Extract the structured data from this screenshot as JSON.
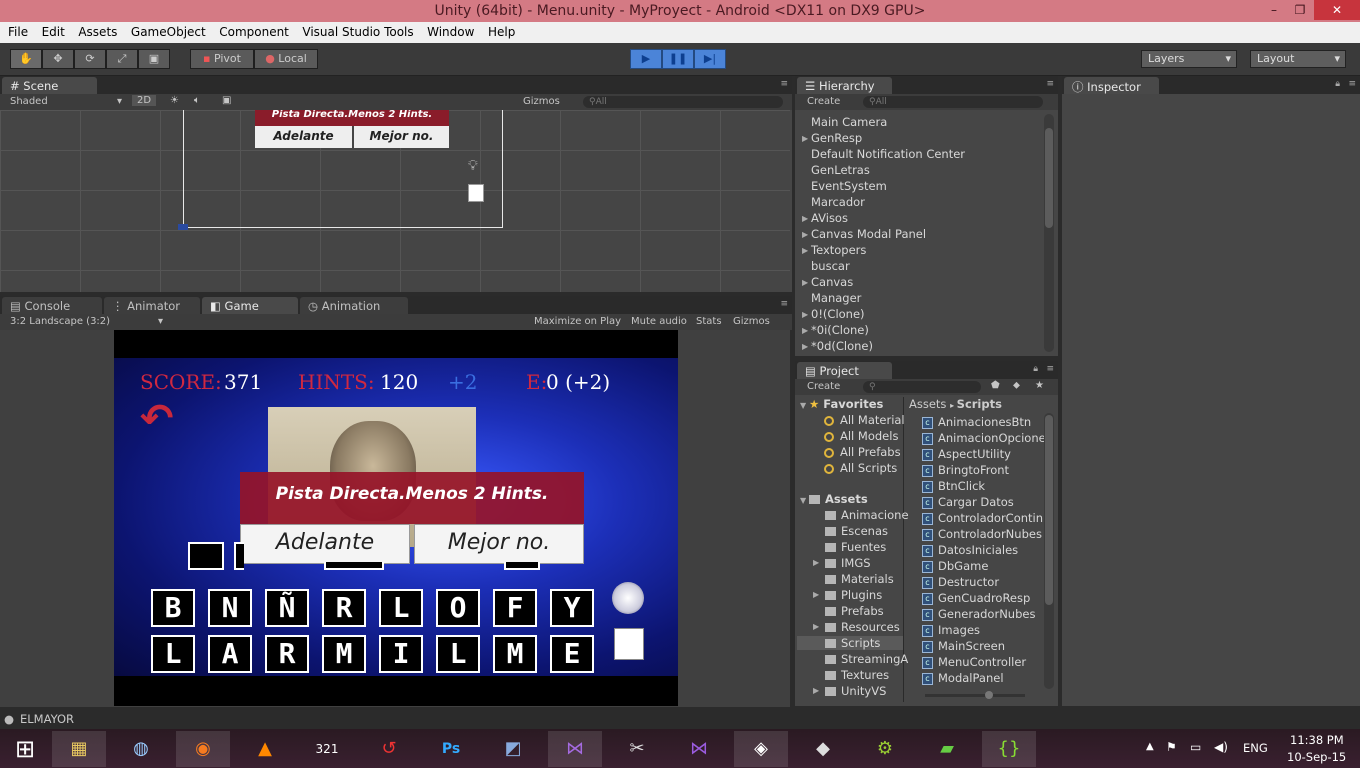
{
  "window": {
    "title": "Unity (64bit) - Menu.unity - MyProyect - Android <DX11 on DX9 GPU>"
  },
  "menu": [
    "File",
    "Edit",
    "Assets",
    "GameObject",
    "Component",
    "Visual Studio Tools",
    "Window",
    "Help"
  ],
  "toolbar": {
    "pivot": "Pivot",
    "local": "Local",
    "layers": "Layers",
    "layout": "Layout"
  },
  "scene": {
    "tab": "Scene",
    "shading": "Shaded",
    "mode2d": "2D",
    "gizmos": "Gizmos",
    "search": "All",
    "popup_text": "Pista Directa.Menos 2 Hints.",
    "btn1": "Adelante",
    "btn2": "Mejor no."
  },
  "bottom_tabs": {
    "console": "Console",
    "animator": "Animator",
    "game": "Game",
    "animation": "Animation"
  },
  "game": {
    "aspect": "3:2 Landscape (3:2)",
    "toolbar": [
      "Maximize on Play",
      "Mute audio",
      "Stats",
      "Gizmos"
    ],
    "score_label": "SCORE:",
    "score_value": "371",
    "hints_label": "HINTS:",
    "hints_value": "120",
    "hints_bonus": "+2",
    "e_label": "E:",
    "e_value": "0 (+2)",
    "popup_text": "Pista Directa.Menos 2 Hints.",
    "btn_continue": "Adelante",
    "btn_cancel": "Mejor no.",
    "letters_row1": [
      "B",
      "N",
      "Ñ",
      "R",
      "L",
      "O",
      "F",
      "Y"
    ],
    "letters_row2": [
      "L",
      "A",
      "R",
      "M",
      "I",
      "L",
      "M",
      "E"
    ]
  },
  "hierarchy": {
    "tab": "Hierarchy",
    "create": "Create",
    "search": "All",
    "items": [
      {
        "label": "Main Camera",
        "arrow": false
      },
      {
        "label": "GenResp",
        "arrow": true
      },
      {
        "label": "Default Notification Center",
        "arrow": false
      },
      {
        "label": "GenLetras",
        "arrow": false
      },
      {
        "label": "EventSystem",
        "arrow": false
      },
      {
        "label": "Marcador",
        "arrow": false
      },
      {
        "label": "AVisos",
        "arrow": true
      },
      {
        "label": "Canvas Modal Panel",
        "arrow": true
      },
      {
        "label": "Textopers",
        "arrow": true
      },
      {
        "label": "buscar",
        "arrow": false
      },
      {
        "label": "Canvas",
        "arrow": true
      },
      {
        "label": "Manager",
        "arrow": false
      },
      {
        "label": "0!(Clone)",
        "arrow": true
      },
      {
        "label": "*0i(Clone)",
        "arrow": true
      },
      {
        "label": "*0d(Clone)",
        "arrow": true
      }
    ]
  },
  "inspector": {
    "tab": "Inspector"
  },
  "project": {
    "tab": "Project",
    "create": "Create",
    "breadcrumb": [
      "Assets",
      "Scripts"
    ],
    "favorites_label": "Favorites",
    "favorites": [
      "All Material",
      "All Models",
      "All Prefabs",
      "All Scripts"
    ],
    "assets_label": "Assets",
    "folders": [
      "Animacione",
      "Escenas",
      "Fuentes",
      "IMGS",
      "Materials",
      "Plugins",
      "Prefabs",
      "Resources",
      "Scripts",
      "StreamingA",
      "Textures",
      "UnityVS"
    ],
    "scripts": [
      "AnimacionesBtn",
      "AnimacionOpcione",
      "AspectUtility",
      "BringtoFront",
      "BtnClick",
      "Cargar Datos",
      "ControladorContin",
      "ControladorNubes",
      "DatosIniciales",
      "DbGame",
      "Destructor",
      "GenCuadroResp",
      "GeneradorNubes",
      "Images",
      "MainScreen",
      "MenuController",
      "ModalPanel"
    ]
  },
  "status": {
    "text": "ELMAYOR"
  },
  "taskbar": {
    "lang": "ENG",
    "time": "11:38 PM",
    "date": "10-Sep-15"
  }
}
